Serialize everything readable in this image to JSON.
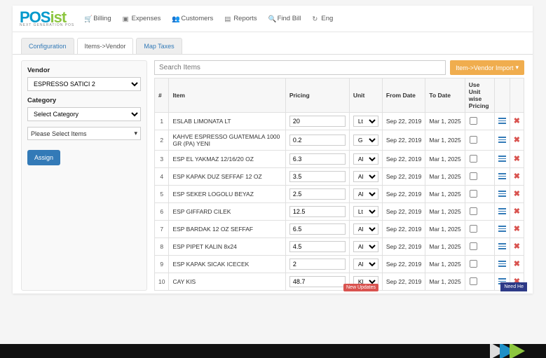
{
  "logo": {
    "prefix": "POS",
    "suffix": "ist",
    "tagline": "NEXT GENERATION POS"
  },
  "topnav": [
    {
      "icon": "cart",
      "label": "Billing"
    },
    {
      "icon": "tag",
      "label": "Expenses"
    },
    {
      "icon": "group",
      "label": "Customers"
    },
    {
      "icon": "bar",
      "label": "Reports"
    },
    {
      "icon": "search",
      "label": "Find Bill"
    },
    {
      "icon": "refresh",
      "label": "Eng"
    }
  ],
  "tabs": [
    {
      "label": "Configuration",
      "active": false
    },
    {
      "label": "Items->Vendor",
      "active": true
    },
    {
      "label": "Map Taxes",
      "active": false
    }
  ],
  "left": {
    "vendor_label": "Vendor",
    "vendor_value": "ESPRESSO SATICI 2",
    "category_label": "Category",
    "category_value": "Select Category",
    "item_select_label": "Please Select Items",
    "assign_label": "Assign"
  },
  "search": {
    "placeholder": "Search Items"
  },
  "import_label": "Item->Vendor Import",
  "columns": {
    "num": "#",
    "item": "Item",
    "pricing": "Pricing",
    "unit": "Unit",
    "from": "From Date",
    "to": "To Date",
    "uwp": "Use Unit wise Pricing"
  },
  "rows": [
    {
      "n": 1,
      "item": "ESLAB LIMONATA LT",
      "price": "20",
      "unit": "Lt",
      "from": "Sep 22, 2019",
      "to": "Mar 1, 2025"
    },
    {
      "n": 2,
      "item": "KAHVE ESPRESSO GUATEMALA 1000 GR (PA) YENI",
      "price": "0.2",
      "unit": "G",
      "from": "Sep 22, 2019",
      "to": "Mar 1, 2025"
    },
    {
      "n": 3,
      "item": "ESP EL YAKMAZ 12/16/20 OZ",
      "price": "6.3",
      "unit": "Al",
      "from": "Sep 22, 2019",
      "to": "Mar 1, 2025"
    },
    {
      "n": 4,
      "item": "ESP KAPAK DUZ SEFFAF 12 OZ",
      "price": "3.5",
      "unit": "Al",
      "from": "Sep 22, 2019",
      "to": "Mar 1, 2025"
    },
    {
      "n": 5,
      "item": "ESP SEKER LOGOLU BEYAZ",
      "price": "2.5",
      "unit": "Al",
      "from": "Sep 22, 2019",
      "to": "Mar 1, 2025"
    },
    {
      "n": 6,
      "item": "ESP GIFFARD CILEK",
      "price": "12.5",
      "unit": "Lt",
      "from": "Sep 22, 2019",
      "to": "Mar 1, 2025"
    },
    {
      "n": 7,
      "item": "ESP BARDAK 12 OZ SEFFAF",
      "price": "6.5",
      "unit": "Al",
      "from": "Sep 22, 2019",
      "to": "Mar 1, 2025"
    },
    {
      "n": 8,
      "item": "ESP PIPET KALIN 8x24",
      "price": "4.5",
      "unit": "Al",
      "from": "Sep 22, 2019",
      "to": "Mar 1, 2025"
    },
    {
      "n": 9,
      "item": "ESP KAPAK SICAK ICECEK",
      "price": "2",
      "unit": "Al",
      "from": "Sep 22, 2019",
      "to": "Mar 1, 2025"
    },
    {
      "n": 10,
      "item": "CAY KIS",
      "price": "48.7",
      "unit": "Kl",
      "from": "Sep 22, 2019",
      "to": "Mar 1, 2025"
    }
  ],
  "badges": {
    "new": "New Updates",
    "help": "Need He"
  }
}
